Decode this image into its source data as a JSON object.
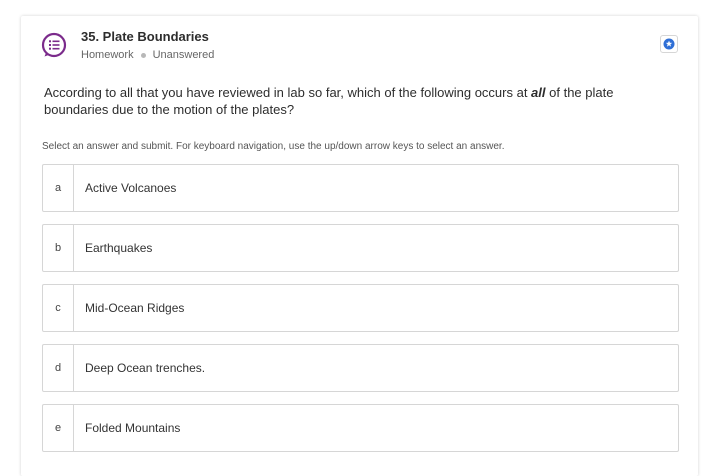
{
  "question": {
    "title": "35. Plate Boundaries",
    "type": "Homework",
    "status": "Unanswered",
    "icon": "question-list-icon",
    "accent_color": "#7b2b8b",
    "prompt_before": "According to all that you have reviewed in lab so far, which of the following occurs at ",
    "prompt_emphasis": "all",
    "prompt_after": " of the plate boundaries due to the motion of the plates?",
    "instructions": "Select an answer and submit. For keyboard navigation, use the up/down arrow keys to select an answer."
  },
  "flag_button": {
    "icon": "star-badge-icon",
    "color": "#2f6fd6"
  },
  "answers": [
    {
      "letter": "a",
      "text": "Active Volcanoes"
    },
    {
      "letter": "b",
      "text": "Earthquakes"
    },
    {
      "letter": "c",
      "text": "Mid-Ocean Ridges"
    },
    {
      "letter": "d",
      "text": "Deep Ocean trenches."
    },
    {
      "letter": "e",
      "text": "Folded Mountains"
    }
  ]
}
